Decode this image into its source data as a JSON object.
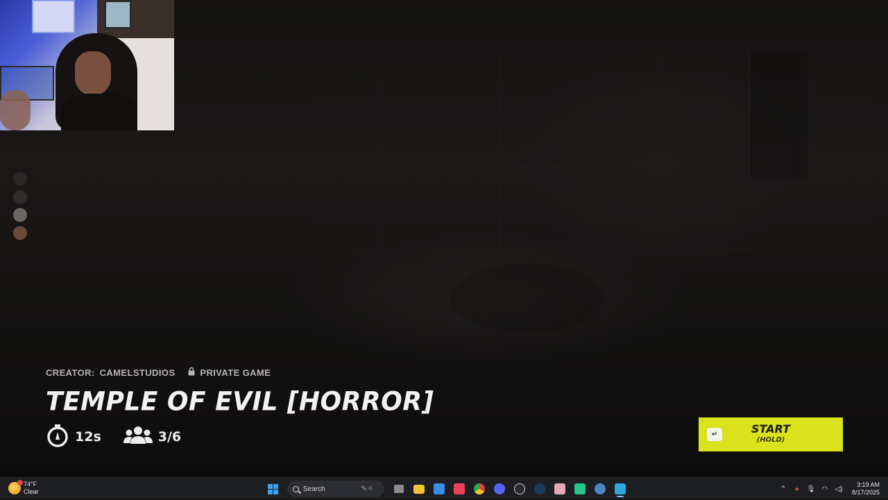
{
  "game": {
    "creator_label": "CREATOR:",
    "creator_name": "CAMELSTUDIOS",
    "privacy": "PRIVATE GAME",
    "title": "TEMPLE OF EVIL [HORROR]",
    "timer": "12s",
    "players": "3/6",
    "start_button": {
      "label": "START",
      "sub": "(HOLD)",
      "key_icon": "enter-key-icon"
    },
    "colors": {
      "accent": "#d9e21a",
      "text": "#f4f2f0",
      "meta": "#b7b4b3"
    }
  },
  "taskbar": {
    "weather": {
      "temp": "74°F",
      "condition": "Clear"
    },
    "search_placeholder": "Search",
    "apps": [
      "file-explorer-icon",
      "microsoft-store-icon",
      "music-icon",
      "chrome-icon",
      "discord-icon",
      "obs-icon",
      "steam-icon",
      "character-app-icon",
      "discord-game-icon",
      "steam-alt-icon",
      "fortnite-icon"
    ],
    "clock": {
      "time": "3:19 AM",
      "date": "8/17/2025"
    }
  }
}
